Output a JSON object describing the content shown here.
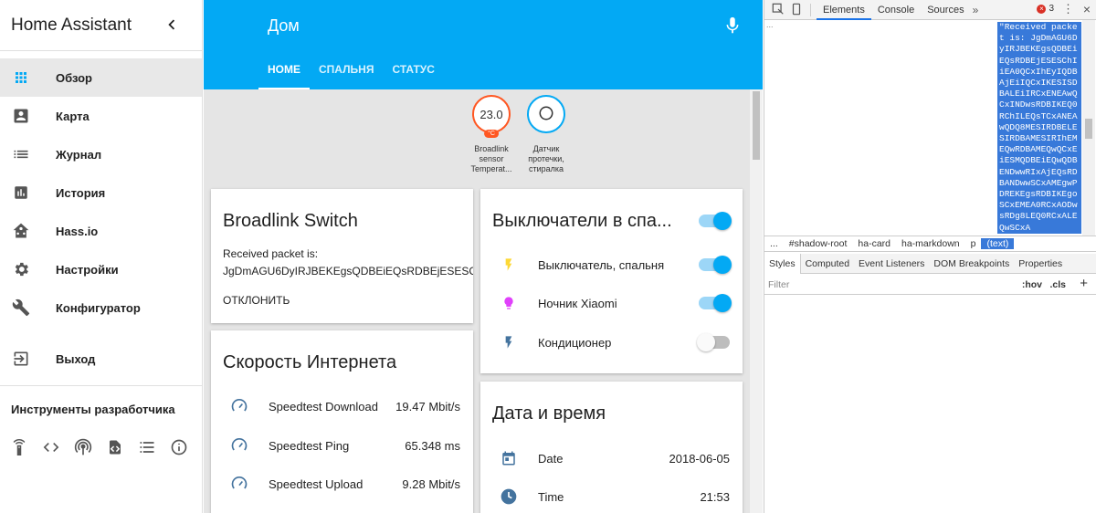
{
  "sidebar": {
    "title": "Home Assistant",
    "items": [
      {
        "label": "Обзор",
        "icon": "apps-icon",
        "active": true
      },
      {
        "label": "Карта",
        "icon": "account-box-icon"
      },
      {
        "label": "Журнал",
        "icon": "list-icon"
      },
      {
        "label": "История",
        "icon": "chart-icon"
      },
      {
        "label": "Hass.io",
        "icon": "hassio-icon"
      },
      {
        "label": "Настройки",
        "icon": "gear-icon"
      },
      {
        "label": "Конфигуратор",
        "icon": "wrench-icon"
      },
      {
        "label": "Выход",
        "icon": "exit-icon"
      }
    ],
    "dev_title": "Инструменты разработчика",
    "dev_icons": [
      "remote-icon",
      "code-icon",
      "broadcast-icon",
      "file-code-icon",
      "template-icon",
      "info-icon"
    ]
  },
  "header": {
    "title": "Дом",
    "tabs": [
      "HOME",
      "СПАЛЬНЯ",
      "СТАТУС"
    ]
  },
  "badges": [
    {
      "value": "23.0",
      "unit": "°C",
      "label": "Broadlink sensor Temperat..."
    },
    {
      "value": "",
      "label": "Датчик протечки, стиралка"
    }
  ],
  "broadlink_card": {
    "title": "Broadlink Switch",
    "line1": "Received packet is:",
    "line2": "JgDmAGU6DyIRJBEKEgsQDBEiEQsRDBEjESESChI",
    "dismiss": "ОТКЛОНИТЬ"
  },
  "switches_card": {
    "title": "Выключатели в спа...",
    "items": [
      {
        "label": "Выключатель, спальня",
        "on": true
      },
      {
        "label": "Ночник Xiaomi",
        "on": true
      },
      {
        "label": "Кондиционер",
        "on": false
      }
    ]
  },
  "speed_card": {
    "title": "Скорость Интернета",
    "items": [
      {
        "label": "Speedtest Download",
        "value": "19.47 Mbit/s"
      },
      {
        "label": "Speedtest Ping",
        "value": "65.348 ms"
      },
      {
        "label": "Speedtest Upload",
        "value": "9.28 Mbit/s"
      }
    ]
  },
  "datetime_card": {
    "title": "Дата и время",
    "items": [
      {
        "label": "Date",
        "value": "2018-06-05"
      },
      {
        "label": "Time",
        "value": "21:53"
      }
    ]
  },
  "devtools": {
    "tabs": [
      "Elements",
      "Console",
      "Sources"
    ],
    "error_count": "3",
    "code": "\"Received packet is: JgDmAGU6DyIRJBEKEgsQDBEiEQsRDBEjESESChIiEA0QCxIhEyIQDBAjEiIQCxIKESISDBALEiIRCxENEAwQCxINDwsRDBIKEQ0RChILEQsTCxANEAwQDQ8MESIRDBELESIRDBAMESIRIhEMEQwRDBAMEQwQCxEiESMQDBEiEQwQDBENDwwRIxAjEQsRDBANDwwSCxAMEgwPDREKEgsRDBIKEgoSCxEMEA0RCxAODwsRDg8LEQ0RCxALEQwSCxA",
    "dots": "...",
    "crumbs": [
      "...",
      "#shadow-root",
      "ha-card",
      "ha-markdown",
      "p",
      "(text)"
    ],
    "subtabs": [
      "Styles",
      "Computed",
      "Event Listeners",
      "DOM Breakpoints",
      "Properties"
    ],
    "filter_placeholder": "Filter",
    "hov": ":hov",
    "cls": ".cls",
    "plus": "+"
  }
}
